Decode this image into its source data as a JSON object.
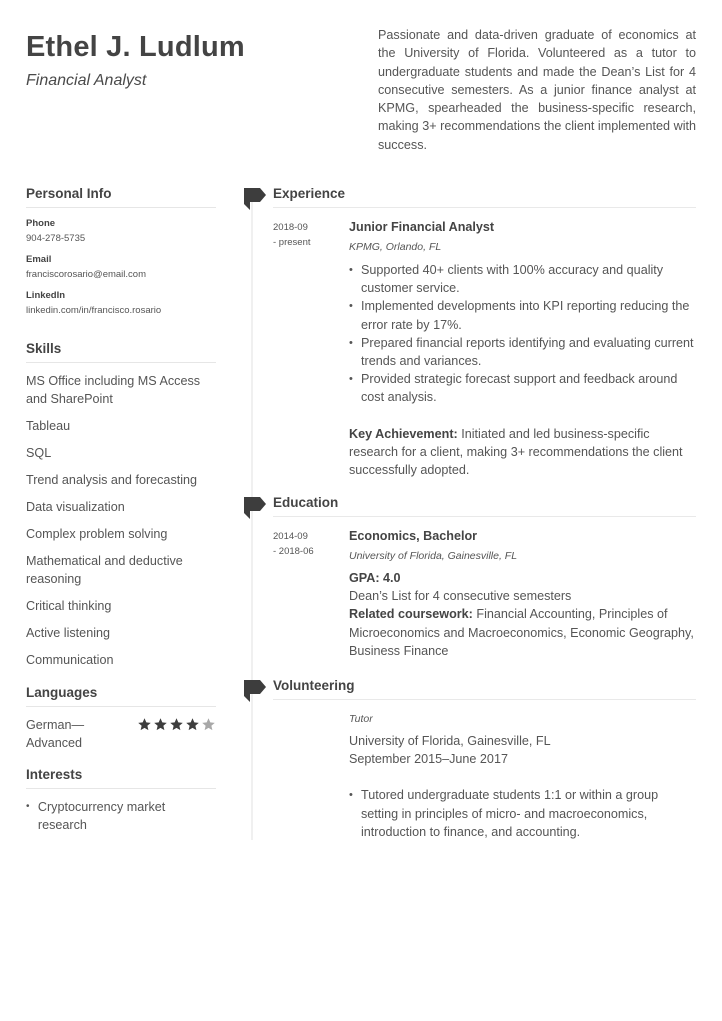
{
  "header": {
    "name": "Ethel J. Ludlum",
    "title": "Financial Analyst",
    "summary": "Passionate and data-driven graduate of economics at the University of Florida. Volunteered as a tutor to undergraduate students and made the Dean’s List for 4 consecutive semesters. As a junior finance analyst at KPMG, spearheaded the business-specific research, making 3+ recommendations the client implemented with success."
  },
  "personal_info": {
    "heading": "Personal Info",
    "phone_label": "Phone",
    "phone": "904-278-5735",
    "email_label": "Email",
    "email": "franciscorosario@email.com",
    "linkedin_label": "LinkedIn",
    "linkedin": "linkedin.com/in/francisco.rosario"
  },
  "skills": {
    "heading": "Skills",
    "items": [
      "MS Office including MS Access and SharePoint",
      "Tableau",
      "SQL",
      "Trend analysis and forecasting",
      "Data visualization",
      "Complex problem solving",
      "Mathematical and deductive reasoning",
      "Critical thinking",
      "Active listening",
      "Communication"
    ]
  },
  "languages": {
    "heading": "Languages",
    "items": [
      {
        "name": "German—Advanced",
        "rating": 4,
        "max": 5
      }
    ]
  },
  "interests": {
    "heading": "Interests",
    "items": [
      "Cryptocurrency market research"
    ]
  },
  "experience": {
    "heading": "Experience",
    "entries": [
      {
        "date_start": "2018-09",
        "date_end": "- present",
        "title": "Junior Financial Analyst",
        "org": "KPMG, Orlando, FL",
        "bullets": [
          "Supported 40+ clients with 100% accuracy and quality customer service.",
          "Implemented developments into KPI reporting reducing the error rate by 17%.",
          "Prepared financial reports identifying and evaluating current trends and variances.",
          "Provided strategic forecast support and feedback around cost analysis."
        ],
        "achievement_label": "Key Achievement:",
        "achievement_text": " Initiated and led business-specific research for a client, making 3+ recommendations the client successfully adopted."
      }
    ]
  },
  "education": {
    "heading": "Education",
    "entries": [
      {
        "date_start": "2014-09",
        "date_end": "- 2018-06",
        "title": "Economics, Bachelor",
        "org": "University of Florida, Gainesville, FL",
        "gpa": "GPA: 4.0",
        "honors": "Dean’s List for 4 consecutive semesters",
        "coursework_label": "Related coursework:",
        "coursework_text": " Financial Accounting, Principles of Microeconomics and Macroeconomics, Economic Geography, Business Finance"
      }
    ]
  },
  "volunteering": {
    "heading": "Volunteering",
    "entries": [
      {
        "role": "Tutor",
        "org": "University of Florida, Gainesville, FL",
        "dates": "September 2015–June 2017",
        "bullets": [
          "Tutored undergraduate students 1:1 or within a group setting in principles of micro- and macroeconomics, introduction to finance, and accounting."
        ]
      }
    ]
  },
  "colors": {
    "heading": "#444444",
    "text": "#555555",
    "star_filled": "#3d3d3d",
    "star_empty": "#a8a8a8",
    "flag": "#3d3d3d",
    "divider": "#e6e6e6"
  }
}
